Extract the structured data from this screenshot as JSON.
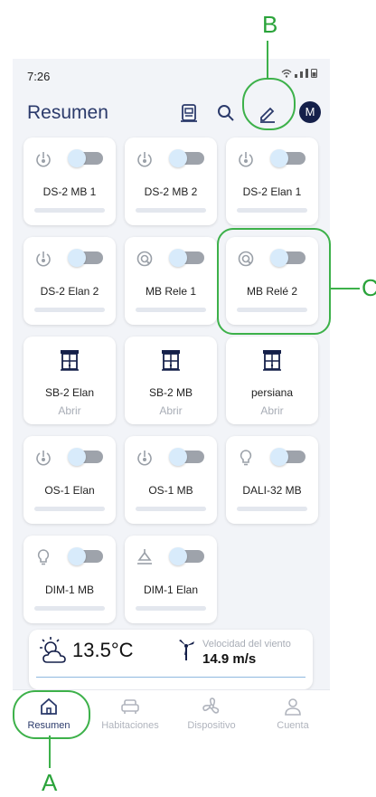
{
  "status": {
    "time": "7:26"
  },
  "header": {
    "title": "Resumen",
    "avatar": "M"
  },
  "devices": [
    {
      "name": "DS-2 MB 1",
      "icon": "power-icon",
      "type": "toggle"
    },
    {
      "name": "DS-2 MB 2",
      "icon": "power-icon",
      "type": "toggle"
    },
    {
      "name": "DS-2 Elan 1",
      "icon": "power-icon",
      "type": "toggle"
    },
    {
      "name": "DS-2 Elan 2",
      "icon": "power-icon",
      "type": "toggle"
    },
    {
      "name": "MB Rele 1",
      "icon": "relay-icon",
      "type": "toggle"
    },
    {
      "name": "MB Relé 2",
      "icon": "relay-icon",
      "type": "toggle"
    },
    {
      "name": "SB-2 Elan",
      "sub": "Abrir",
      "icon": "blind-icon",
      "type": "blind"
    },
    {
      "name": "SB-2 MB",
      "sub": "Abrir",
      "icon": "blind-icon",
      "type": "blind"
    },
    {
      "name": "persiana",
      "sub": "Abrir",
      "icon": "blind-icon",
      "type": "blind"
    },
    {
      "name": "OS-1 Elan",
      "icon": "power-icon",
      "type": "toggle"
    },
    {
      "name": "OS-1 MB",
      "icon": "power-icon",
      "type": "toggle"
    },
    {
      "name": "DALI-32 MB",
      "icon": "bulb-icon",
      "type": "toggle"
    },
    {
      "name": "DIM-1 MB",
      "icon": "bulb-icon",
      "type": "toggle"
    },
    {
      "name": "DIM-1 Elan",
      "icon": "lamp-icon",
      "type": "toggle"
    }
  ],
  "weather": {
    "temperature": "13.5°C",
    "wind_label": "Velocidad del viento",
    "wind_value": "14.9 m/s"
  },
  "nav": [
    {
      "label": "Resumen",
      "icon": "home-icon",
      "active": true
    },
    {
      "label": "Habitaciones",
      "icon": "sofa-icon",
      "active": false
    },
    {
      "label": "Dispositivo",
      "icon": "fan-icon",
      "active": false
    },
    {
      "label": "Cuenta",
      "icon": "user-icon",
      "active": false
    }
  ],
  "annotations": {
    "a": "A",
    "b": "B",
    "c": "C"
  },
  "colors": {
    "accent": "#2b3a6b",
    "callout": "#3db14a",
    "avatar": "#15204a"
  }
}
